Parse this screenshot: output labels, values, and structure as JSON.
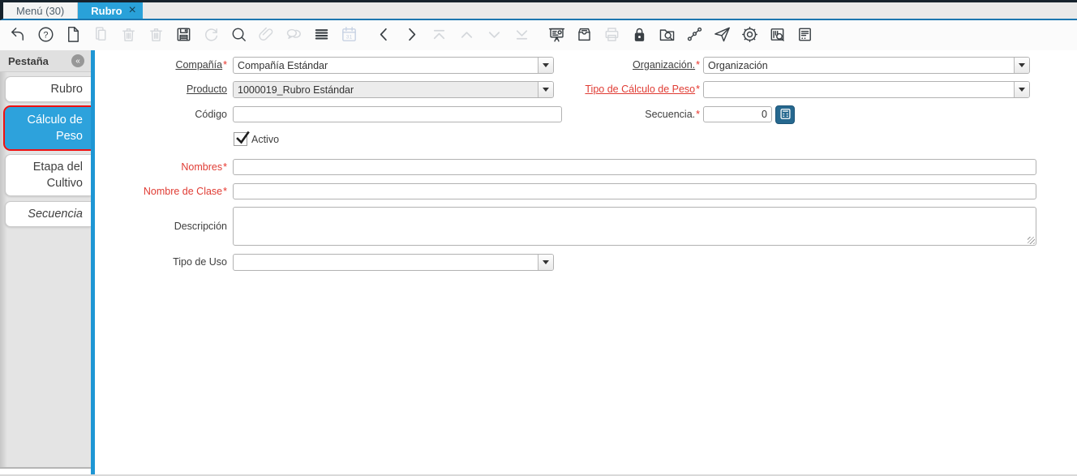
{
  "window": {
    "tabs": [
      {
        "label": "Menú (30)",
        "active": false,
        "closable": false
      },
      {
        "label": "Rubro",
        "active": true,
        "closable": true,
        "close_glyph": "×"
      }
    ]
  },
  "toolbar": {
    "buttons": [
      {
        "name": "undo",
        "disabled": false
      },
      {
        "name": "help",
        "disabled": false
      },
      {
        "name": "new-record",
        "disabled": false
      },
      {
        "name": "copy-record",
        "disabled": true
      },
      {
        "name": "delete-record",
        "disabled": true
      },
      {
        "name": "delete-selection",
        "disabled": true
      },
      {
        "name": "save",
        "disabled": false
      },
      {
        "name": "refresh",
        "disabled": true
      },
      {
        "name": "find",
        "disabled": false
      },
      {
        "name": "attachment",
        "disabled": true
      },
      {
        "name": "chat",
        "disabled": true
      },
      {
        "name": "grid-toggle",
        "disabled": false
      },
      {
        "name": "calendar",
        "disabled": true,
        "tone": "calendar"
      },
      {
        "name": "previous-record",
        "disabled": false,
        "gap": true
      },
      {
        "name": "next-record",
        "disabled": false
      },
      {
        "name": "parent-record",
        "disabled": true
      },
      {
        "name": "up",
        "disabled": true
      },
      {
        "name": "down",
        "disabled": true
      },
      {
        "name": "detail-record",
        "disabled": true
      },
      {
        "name": "report",
        "disabled": false,
        "gap": true
      },
      {
        "name": "archive",
        "disabled": false
      },
      {
        "name": "print",
        "disabled": true
      },
      {
        "name": "lock",
        "disabled": false
      },
      {
        "name": "zoom-across",
        "disabled": false
      },
      {
        "name": "workflow",
        "disabled": false
      },
      {
        "name": "send-mail",
        "disabled": false
      },
      {
        "name": "process",
        "disabled": false
      },
      {
        "name": "product-info",
        "disabled": false
      },
      {
        "name": "notes",
        "disabled": false
      }
    ]
  },
  "sidebar": {
    "header": "Pestaña",
    "collapse_glyph": "«",
    "tabs": [
      {
        "id": "rubro",
        "label": "Rubro",
        "selected": false,
        "highlighted": false,
        "italic": false
      },
      {
        "id": "calculo-de-peso",
        "label": "Cálculo de Peso",
        "selected": true,
        "highlighted": true,
        "italic": false
      },
      {
        "id": "etapa-del-cultivo",
        "label": "Etapa del Cultivo",
        "selected": false,
        "highlighted": false,
        "italic": false
      },
      {
        "id": "secuencia",
        "label": "Secuencia",
        "selected": false,
        "highlighted": false,
        "italic": true
      }
    ]
  },
  "form": {
    "required_marker": "*",
    "fields": {
      "compania": {
        "label": "Compañía",
        "value": "Compañía Estándar"
      },
      "organizacion": {
        "label": "Organización.",
        "value": "Organización"
      },
      "producto": {
        "label": "Producto",
        "value": "1000019_Rubro Estándar"
      },
      "tipo_calculo_peso": {
        "label": "Tipo de Cálculo de Peso",
        "value": ""
      },
      "codigo": {
        "label": "Código",
        "value": ""
      },
      "secuencia": {
        "label": "Secuencia.",
        "value": "0"
      },
      "activo": {
        "label": "Activo",
        "checked": true
      },
      "nombres": {
        "label": "Nombres",
        "value": ""
      },
      "nombre_clase": {
        "label": "Nombre de Clase",
        "value": ""
      },
      "descripcion": {
        "label": "Descripción",
        "value": ""
      },
      "tipo_uso": {
        "label": "Tipo de Uso",
        "value": ""
      }
    }
  },
  "colors": {
    "accent_blue": "#29a1d9",
    "tab_underline": "#1b76af",
    "top_border": "#16222c",
    "divider_blue": "#1e96d4",
    "highlight_red": "#ee1111",
    "required_red": "#e8332a",
    "calc_button_blue": "#26688f",
    "readonly_gray": "#ececec"
  }
}
